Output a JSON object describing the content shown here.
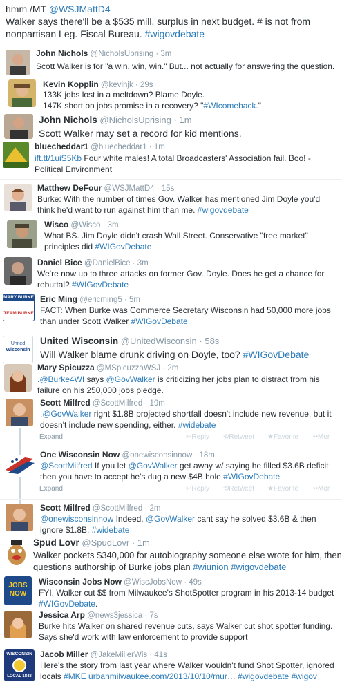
{
  "top_tweet": {
    "line1_plain": "hmm /MT ",
    "line1_handle": "@WSJMattD4",
    "line2": "Walker says there'll be a $535 mill. surplus in  next budget. # is not from",
    "line3_plain": "nonpartisan Leg. Fiscal Bureau. ",
    "line3_tag": "#wigovdebate"
  },
  "tweets": [
    {
      "name": "John Nichols",
      "handle": "@NicholsUprising",
      "time": "· 3m",
      "text": "Scott Walker is for \"a win, win, win.\" But... not actually for answering the question."
    },
    {
      "name": "Kevin Kopplin",
      "handle": "@kevinjk",
      "time": "· 29s",
      "text1": "133K jobs lost in a meltdown?  Blame Doyle.",
      "text2": "147K short on jobs promise in a recovery?  \"",
      "tag": "#WIcomeback",
      "text2_end": ".\""
    },
    {
      "name": "John Nichols",
      "handle": "@NicholsUprising",
      "time": "· 1m",
      "text": "Scott Walker may set a record for kid mentions."
    },
    {
      "name": "bluecheddar1",
      "handle": "@bluecheddar1",
      "time": "· 1m",
      "link": "ift.tt/1uiS5Kb",
      "text1": " Four white males! A total Broadcasters' Association fail. Boo! -",
      "text2": "Political Environment"
    },
    {
      "name": "Matthew DeFour",
      "handle": "@WSJMattD4",
      "time": "· 15s",
      "text1": "Burke: With the number of times Gov. Walker has mentioned Jim Doyle you'd",
      "text2": "think he'd want to run against him than me. ",
      "tag": "#wigovdebate"
    },
    {
      "name": "Wisco",
      "handle": "@Wisco",
      "time": "· 3m",
      "text1": "What BS. Jim Doyle didn't crash Wall Street. Conservative \"free market\"",
      "text2": "principles did ",
      "tag": "#WIGovDebate"
    },
    {
      "name": "Daniel Bice",
      "handle": "@DanielBice",
      "time": "· 3m",
      "text1": "We're now up to three attacks on former Gov. Doyle. Does he get a chance for",
      "text2": "rebuttal? ",
      "tag": "#WIGovDebate"
    },
    {
      "name": "Eric Ming",
      "handle": "@ericming5",
      "time": "· 5m",
      "avatar_top": "MARY BURKE",
      "avatar_bottom": "TEAM BURKE",
      "text1": "FACT: When Burke was Commerce Secretary Wisconsin had 50,000 more jobs",
      "text2": "than under Scott Walker ",
      "tag": "#WIGovDebate"
    },
    {
      "name": "United Wisconsin",
      "handle": "@UnitedWisconsin",
      "time": "· 58s",
      "avatar_line1": "United",
      "avatar_line2": "Wisconsin",
      "text": "Will Walker blame drunk driving on Doyle, too? ",
      "tag": "#WIGovDebate"
    },
    {
      "name": "Mary Spicuzza",
      "handle": "@MSpicuzzaWSJ",
      "time": "· 2m",
      "m1": ".@Burke4WI",
      "t1": " says ",
      "m2": "@GovWalker",
      "t2": " is criticizing her jobs plan to distract from his",
      "text2": "failure on his 250,000 jobs pledge."
    },
    {
      "name": "Scott Milfred",
      "handle": "@ScottMilfred",
      "time": "· 19m",
      "m1": ".@GovWalker",
      "t1": " right $1.8B projected shortfall doesn't include new revenue, but it",
      "text2": "doesn't include new spending, either. ",
      "tag": "#widebate"
    },
    {
      "name": "One Wisconsin Now",
      "handle": "@onewisconsinnow",
      "time": "· 18m",
      "m1": "@ScottMilfred",
      "t1": " If you let ",
      "m2": "@GovWalker",
      "t2": " get away w/ saying he filled $3.6B deficit",
      "text2": "then you have to accept he's dug a new $4B hole ",
      "tag": "#WIGovDebate"
    },
    {
      "name": "Scott Milfred",
      "handle": "@ScottMilfred",
      "time": "· 2m",
      "m1": "@onewisconsinnow",
      "t1": " Indeed, ",
      "m2": "@GovWalker",
      "t2": " cant say he solved $3.6B & then",
      "text2": "ignore $1.8B. ",
      "tag": "#widebate"
    },
    {
      "name": "Spud Lovr",
      "handle": "@SpudLovr",
      "time": "· 1m",
      "text1": "Walker pockets $340,000 for autobiography someone else wrote for him, then",
      "text2": "questions authorship of Burke jobs plan ",
      "tag1": "#wiunion",
      "tag2": "#wigovdebate"
    },
    {
      "name": "Wisconsin Jobs Now",
      "handle": "@WiscJobsNow",
      "time": "· 49s",
      "avatar_line1": "JOBS",
      "avatar_line2": "NOW",
      "text1": "FYI, Walker cut $$ from Milwaukee's ShotSpotter program in his 2013-14 budget",
      "tag": "#WIGovDebate",
      "tag_end": "."
    },
    {
      "name": "Jessica Arp",
      "handle": "@news3jessica",
      "time": "· 7s",
      "text1": "Burke hits Walker on shared revenue cuts, says Walker cut shot spotter funding.",
      "text2": "Says she'd work with law enforcement to provide support"
    },
    {
      "name": "Jacob Miller",
      "handle": "@JakeMillerWis",
      "time": "· 41s",
      "avatar_top": "WISCONSIN",
      "avatar_bottom": "LOCAL 1848",
      "text1": "Here's the story from last year where Walker wouldn't fund Shot Spotter, ignored",
      "text2a": "locals ",
      "tag1": "#MKE",
      "link": "urbanmilwaukee.com/2013/10/10/mur…",
      "tag2": "#wigovdebate",
      "tag3": "#wigov"
    }
  ],
  "actions": {
    "expand": "Expand",
    "reply": "Reply",
    "retweet": "Retweet",
    "favorite": "Favorite",
    "more": "Mor"
  },
  "colors": {
    "link": "#2b7bb9",
    "meta": "#8899a6",
    "text": "#292f33"
  }
}
